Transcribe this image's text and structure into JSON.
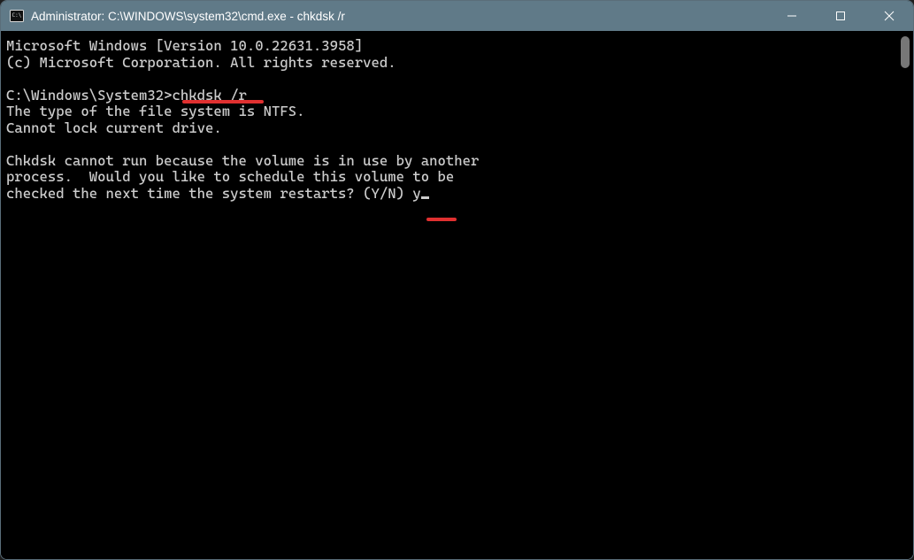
{
  "window": {
    "title": "Administrator: C:\\WINDOWS\\system32\\cmd.exe - chkdsk  /r"
  },
  "terminal": {
    "line1": "Microsoft Windows [Version 10.0.22631.3958]",
    "line2": "(c) Microsoft Corporation. All rights reserved.",
    "blank1": "",
    "prompt": "C:\\Windows\\System32>",
    "command": "chkdsk /r",
    "out1": "The type of the file system is NTFS.",
    "out2": "Cannot lock current drive.",
    "blank2": "",
    "out3": "Chkdsk cannot run because the volume is in use by another",
    "out4": "process.  Would you like to schedule this volume to be",
    "out5a": "checked the next time the system restarts? (Y/N) ",
    "answer": "y"
  },
  "icons": {
    "app": "cmd-icon",
    "minimize": "minimize-icon",
    "maximize": "maximize-icon",
    "close": "close-icon"
  }
}
